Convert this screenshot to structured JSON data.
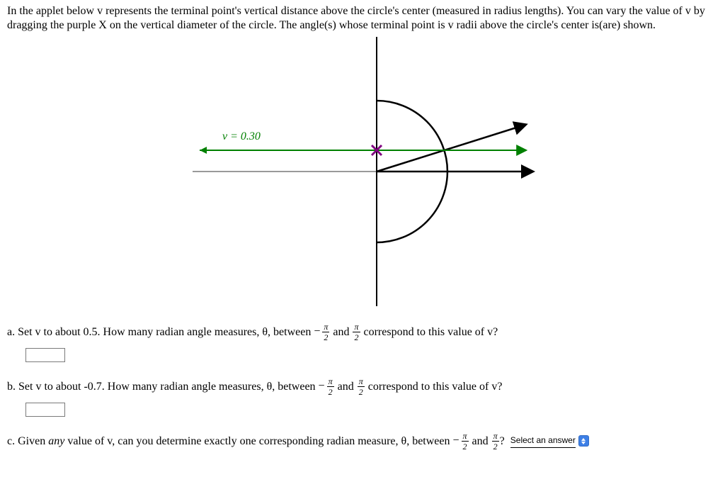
{
  "intro": "In the applet below v represents the terminal point's vertical distance above the circle's center (measured in radius lengths). You can vary the value of v by dragging the purple X on the vertical diameter of the circle. The angle(s) whose terminal point is v radii above the circle's center is(are) shown.",
  "applet": {
    "v_label": "v = 0.30",
    "v_value": 0.3
  },
  "chart_data": {
    "type": "diagram",
    "title": "Unit circle with horizontal chord at height v",
    "v": 0.3,
    "radius": 1,
    "axes": {
      "x_visible_range": [
        -2.6,
        2.2
      ],
      "y_visible_range": [
        -1.9,
        1.9
      ]
    },
    "drawn_angles_rad": [
      0.3047
    ],
    "annotations": [
      "v = 0.30"
    ]
  },
  "qa": {
    "a_pre": "a. Set v to about 0.5. How many radian angle measures, θ, between ",
    "a_post": " correspond to this value of v?",
    "b_pre": "b. Set v to about -0.7. How many radian angle measures, θ, between ",
    "b_post": " correspond to this value of v?",
    "c_pre": "c. Given ",
    "c_any": "any",
    "c_mid": " value of v, can you determine exactly one corresponding radian measure, θ, between ",
    "c_post": "?",
    "and": " and ",
    "pi": "π",
    "two": "2",
    "select_label": "Select an answer"
  }
}
